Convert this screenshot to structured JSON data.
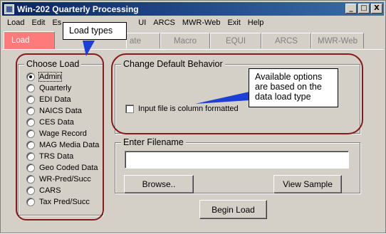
{
  "window": {
    "title": "Win-202 Quarterly Processing",
    "minimize_glyph": "_",
    "maximize_glyph": "□",
    "close_glyph": "X"
  },
  "menu": [
    {
      "label": "Load"
    },
    {
      "label": "Edit"
    },
    {
      "label": "Es"
    },
    {
      "label": "UI"
    },
    {
      "label": "ARCS"
    },
    {
      "label": "MWR-Web"
    },
    {
      "label": "Exit"
    },
    {
      "label": "Help"
    }
  ],
  "tabs": [
    {
      "label": "Load",
      "active": true
    },
    {
      "label": "ate"
    },
    {
      "label": "Macro"
    },
    {
      "label": "EQUI"
    },
    {
      "label": "ARCS"
    },
    {
      "label": "MWR-Web"
    }
  ],
  "choose_load": {
    "title": "Choose Load",
    "selected": "Admin",
    "options": [
      "Admin",
      "Quarterly",
      "EDI Data",
      "NAICS Data",
      "CES Data",
      "Wage Record",
      "MAG Media Data",
      "TRS Data",
      "Geo Coded Data",
      "WR-Pred/Succ",
      "CARS",
      "Tax Pred/Succ"
    ]
  },
  "default_behavior": {
    "title": "Change Default Behavior",
    "checkbox_label": "Input file is column formatted",
    "checked": false
  },
  "filename": {
    "title": "Enter Filename",
    "value": "",
    "browse_label": "Browse..",
    "sample_label": "View Sample"
  },
  "begin_label": "Begin Load",
  "callouts": {
    "load_types": "Load types",
    "available_options": "Available options are based on the data load type"
  },
  "colors": {
    "title_bar": "#0a246a",
    "active_tab": "#ff7a7a",
    "annotation_oval": "#8b1a1a",
    "callout_arrow": "#1c3fd6"
  }
}
